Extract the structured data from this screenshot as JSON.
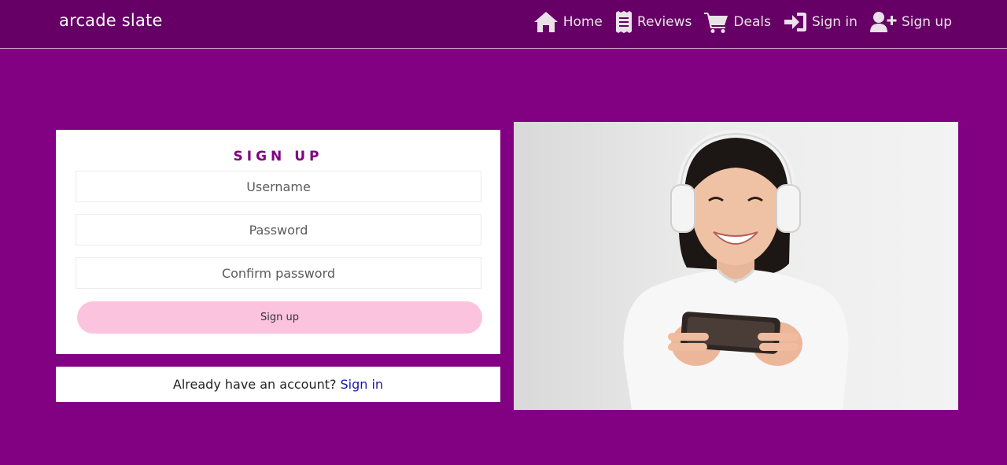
{
  "brand": "arcade slate",
  "nav": [
    {
      "label": "Home",
      "icon": "home-icon"
    },
    {
      "label": "Reviews",
      "icon": "receipt-icon"
    },
    {
      "label": "Deals",
      "icon": "cart-icon"
    },
    {
      "label": "Sign in",
      "icon": "sign-in-icon"
    },
    {
      "label": "Sign up",
      "icon": "user-plus-icon"
    }
  ],
  "signup": {
    "title": "SIGN UP",
    "username_placeholder": "Username",
    "password_placeholder": "Password",
    "confirm_placeholder": "Confirm password",
    "submit_label": "Sign up"
  },
  "account": {
    "prompt": "Already have an account?",
    "link": "Sign in"
  },
  "hero": {
    "subject": "woman-with-headphones-holding-phone-photo"
  },
  "colors": {
    "page_bg": "#820082",
    "navbar_bg": "#660066",
    "title": "#820082",
    "button_bg": "#fcc3de",
    "link": "#1a1aa8"
  }
}
